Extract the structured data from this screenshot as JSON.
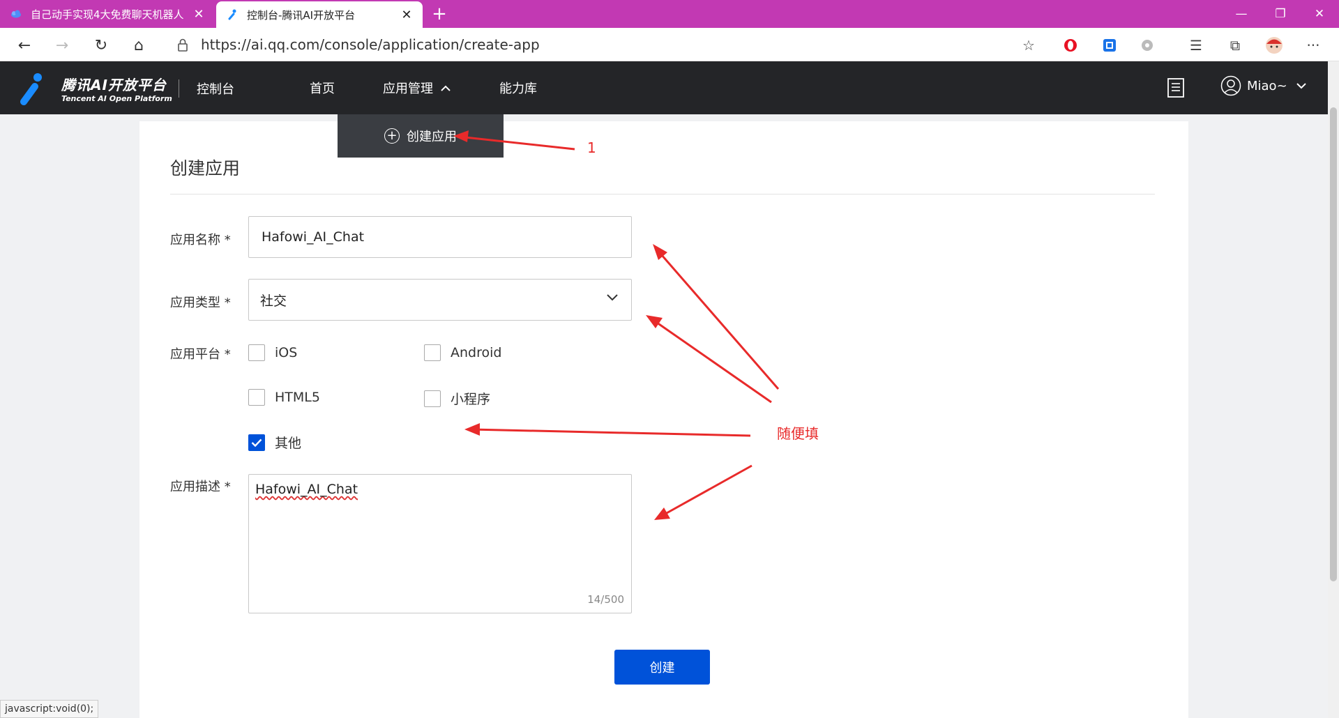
{
  "browser": {
    "tabs": [
      {
        "title": "自己动手实现4大免费聊天机器人",
        "active": false
      },
      {
        "title": "控制台-腾讯AI开放平台",
        "active": true
      }
    ],
    "url": "https://ai.qq.com/console/application/create-app",
    "status_text": "javascript:void(0);"
  },
  "site_header": {
    "logo_cn": "腾讯AI开放平台",
    "logo_en": "Tencent AI Open Platform",
    "console": "控制台",
    "menu": [
      "首页",
      "应用管理",
      "能力库"
    ],
    "user": "Miao~"
  },
  "dropdown": {
    "item": "创建应用"
  },
  "form": {
    "title": "创建应用",
    "name_label": "应用名称 *",
    "name_value": "Hafowi_AI_Chat",
    "type_label": "应用类型 *",
    "type_value": "社交",
    "platform_label": "应用平台 *",
    "platforms": [
      {
        "label": "iOS",
        "checked": false
      },
      {
        "label": "Android",
        "checked": false
      },
      {
        "label": "HTML5",
        "checked": false
      },
      {
        "label": "小程序",
        "checked": false
      },
      {
        "label": "其他",
        "checked": true
      }
    ],
    "desc_label": "应用描述 *",
    "desc_value": "Hafowi_AI_Chat",
    "desc_counter": "14/500",
    "submit_label": "创建"
  },
  "annotations": {
    "step_label": "1",
    "fill_hint": "随便填",
    "color": "#e82a2a"
  },
  "theme": {
    "tabbar": "#c239b3",
    "header": "#242528",
    "primary": "#0052d9"
  }
}
